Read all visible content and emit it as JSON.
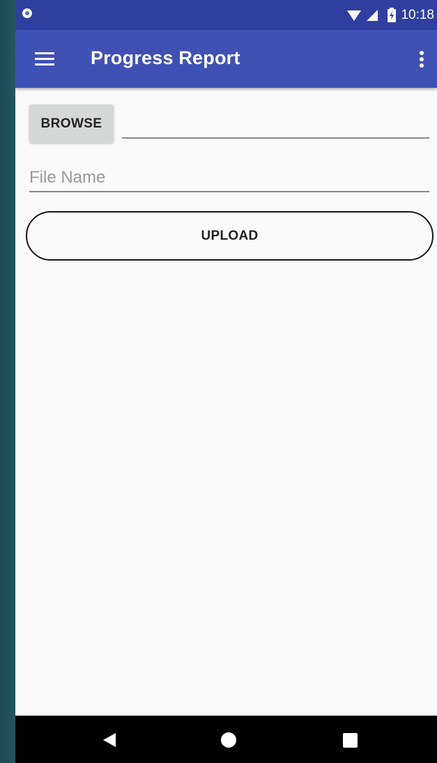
{
  "status_bar": {
    "time": "10:18"
  },
  "app_bar": {
    "title": "Progress Report",
    "menu_icon": "hamburger-menu-icon",
    "overflow_icon": "more-vert-icon"
  },
  "form": {
    "browse_label": "BROWSE",
    "path_value": "",
    "file_name_placeholder": "File Name",
    "upload_label": "UPLOAD"
  },
  "colors": {
    "status_bar": "#303f9f",
    "app_bar": "#3f51b5",
    "background": "#fafafa",
    "browse_button": "#d6d7d7"
  },
  "nav_bar": {
    "back_icon": "back-icon",
    "home_icon": "home-icon",
    "recents_icon": "recents-icon"
  }
}
